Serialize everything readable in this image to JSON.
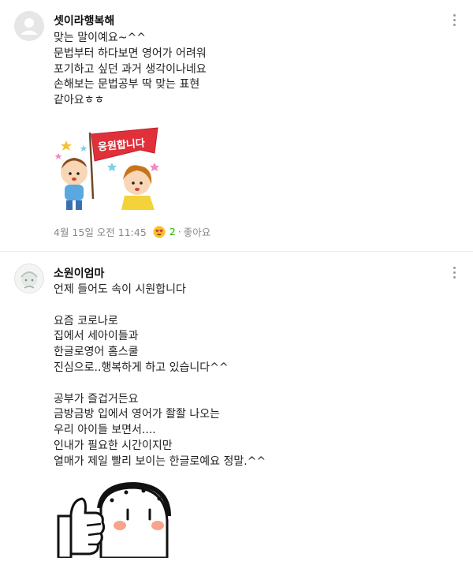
{
  "comments": [
    {
      "author": "셋이라행복해",
      "text": "맞는 말이예요~^^\n문법부터 하다보면 영어가 어려워\n포기하고 싶던 과거 생각이나네요\n손해보는 문법공부 딱 맞는 표현\n같아요ㅎㅎ",
      "sticker_text": "응원합니다",
      "timestamp": "4월 15일 오전 11:45",
      "reaction_dot": "·",
      "reaction_count": "2",
      "like_label": "좋아요"
    },
    {
      "author": "소원이엄마",
      "text": "언제 들어도 속이 시원합니다\n\n요즘 코로나로\n집에서 세아이들과\n한글로영어 홈스쿨\n진심으로..행복하게 하고 있습니다^^\n\n공부가 즐겁거든요\n금방금방 입에서 영어가 좔좔 나오는\n우리 아이들 보면서....\n인내가 필요한 시간이지만\n열매가 제일 빨리 보이는 한글로예요 정말.^^"
    }
  ],
  "icons": {
    "avatar1": "default-avatar-icon",
    "avatar2": "user-avatar-icon",
    "more": "more-vertical-icon",
    "reaction": "heart-eyes-emoji-icon"
  },
  "colors": {
    "reaction_count": "#2db400",
    "flag": "#e0303a"
  }
}
